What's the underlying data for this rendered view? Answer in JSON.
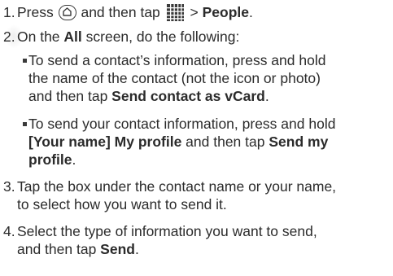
{
  "icons": {
    "home": "home-button-icon",
    "apps": "all-apps-grid-icon"
  },
  "steps": [
    {
      "number": "1.",
      "parts": [
        "Press ",
        " and then tap ",
        " > ",
        "People",
        "."
      ]
    },
    {
      "number": "2.",
      "parts": [
        "On the ",
        "All",
        " screen, do the following:"
      ],
      "bullets": [
        {
          "lines": [
            "To send a contact’s information, press and hold",
            "the name of the contact (not the icon or photo)"
          ],
          "line3_prefix": "and then tap ",
          "line3_bold": "Send contact as vCard",
          "line3_suffix": "."
        },
        {
          "line1": "To send your contact information, press and hold",
          "line2_bold": "[Your name] My profile",
          "line2_mid": " and then tap ",
          "line2_bold2": "Send my",
          "line3_bold": "profile",
          "line3_suffix": "."
        }
      ]
    },
    {
      "number": "3.",
      "lines": [
        "Tap the box under the contact name or your name,",
        "to select how you want to send it."
      ]
    },
    {
      "number": "4.",
      "line1": "Select the type of information you want to send,",
      "line2_prefix": "and then tap ",
      "line2_bold": "Send",
      "line2_suffix": "."
    }
  ]
}
